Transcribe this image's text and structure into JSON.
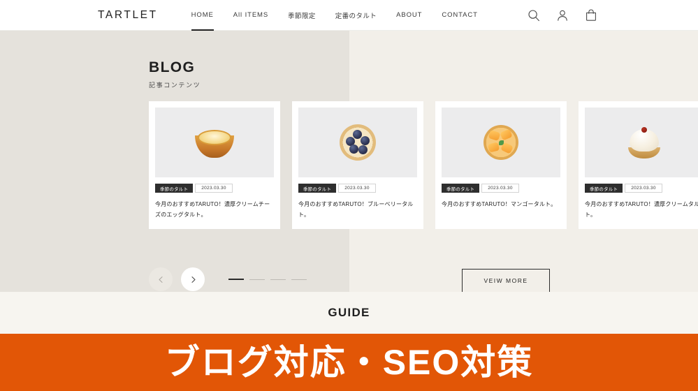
{
  "header": {
    "brand": "TARTLET",
    "nav": [
      {
        "label": "HOME",
        "active": true,
        "jp": false
      },
      {
        "label": "All ITEMS",
        "active": false,
        "jp": false
      },
      {
        "label": "季節限定",
        "active": false,
        "jp": true
      },
      {
        "label": "定番のタルト",
        "active": false,
        "jp": true
      },
      {
        "label": "ABOUT",
        "active": false,
        "jp": false
      },
      {
        "label": "CONTACT",
        "active": false,
        "jp": false
      }
    ],
    "icons": [
      {
        "name": "search-icon"
      },
      {
        "name": "account-icon"
      },
      {
        "name": "cart-icon"
      }
    ]
  },
  "blog": {
    "title": "BLOG",
    "subtitle": "記事コンテンツ",
    "cards": [
      {
        "tag": "季節のタルト",
        "date": "2023.03.30",
        "title": "今月のおすすめTARUTO！濃厚クリームチーズのエッグタルト。",
        "image": "egg-tart-photo"
      },
      {
        "tag": "季節のタルト",
        "date": "2023.03.30",
        "title": "今月のおすすめTARUTO！ブルーベリータルト。",
        "image": "blueberry-tart-photo"
      },
      {
        "tag": "季節のタルト",
        "date": "2023.03.30",
        "title": "今月のおすすめTARUTO！マンゴータルト。",
        "image": "mango-tart-photo"
      },
      {
        "tag": "季節のタルト",
        "date": "2023.03.30",
        "title": "今月のおすすめTARUTO！濃厚クリームタルト。",
        "image": "cream-tart-photo"
      }
    ],
    "carousel": {
      "prev_label": "‹",
      "next_label": "›",
      "slides": 4,
      "active_slide": 1
    },
    "view_more_label": "VEIW MORE"
  },
  "guide": {
    "title": "GUIDE"
  },
  "banner": {
    "text": "ブログ対応・SEO対策",
    "background_color": "#e25606",
    "text_color": "#ffffff"
  },
  "colors": {
    "page_bg": "#f2efe9",
    "blog_left_bg": "#e5e2dc",
    "header_bg": "#ffffff",
    "guide_bg": "#f7f5f0",
    "accent_orange": "#e25606",
    "tag_bg": "#2e2e2e"
  }
}
